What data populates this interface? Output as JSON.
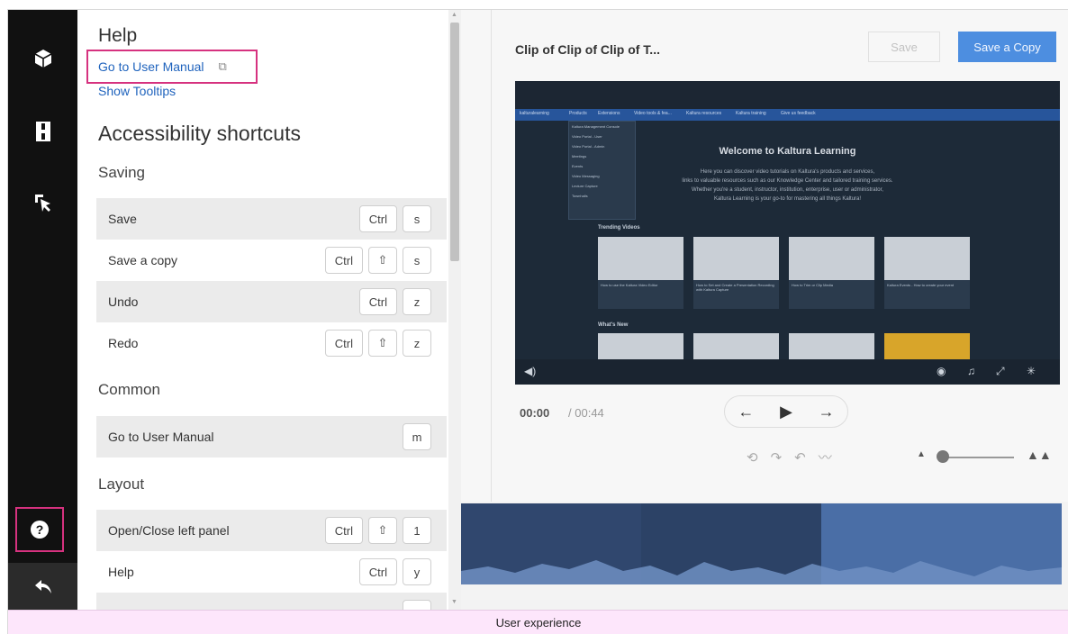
{
  "colors": {
    "highlight": "#d6327f",
    "link": "#1f63bd",
    "primary": "#4d8ee0",
    "rail": "#111111"
  },
  "rail": {
    "items": [
      {
        "icon": "cube-icon"
      },
      {
        "icon": "film-strip-icon"
      },
      {
        "icon": "cursor-select-icon"
      }
    ],
    "help_icon": "question-icon",
    "back_icon": "back-arrow-icon"
  },
  "help": {
    "title": "Help",
    "manual_link": "Go to User Manual",
    "manual_link_icon": "external-link-icon",
    "tooltips_link": "Show Tooltips",
    "accessibility_title": "Accessibility shortcuts",
    "sections": {
      "saving": {
        "title": "Saving",
        "rows": [
          {
            "label": "Save",
            "keys": [
              "Ctrl",
              "s"
            ]
          },
          {
            "label": "Save a copy",
            "keys": [
              "Ctrl",
              "⇧",
              "s"
            ]
          },
          {
            "label": "Undo",
            "keys": [
              "Ctrl",
              "z"
            ]
          },
          {
            "label": "Redo",
            "keys": [
              "Ctrl",
              "⇧",
              "z"
            ]
          }
        ]
      },
      "common": {
        "title": "Common",
        "rows": [
          {
            "label": "Go to User Manual",
            "keys": [
              "m"
            ]
          }
        ]
      },
      "layout": {
        "title": "Layout",
        "rows": [
          {
            "label": "Open/Close left panel",
            "keys": [
              "Ctrl",
              "⇧",
              "1"
            ]
          },
          {
            "label": "Help",
            "keys": [
              "Ctrl",
              "y"
            ]
          }
        ]
      }
    }
  },
  "editor": {
    "clip_title": "Clip of Clip of Clip of T...",
    "save_label": "Save",
    "save_copy_label": "Save a Copy",
    "time_current": "00:00",
    "time_separator": "/",
    "time_total": "00:44",
    "player": {
      "welcome_title": "Welcome to Kaltura Learning",
      "welcome_lines": [
        "Here you can discover video tutorials on Kaltura's products and services,",
        "links to valuable resources such as our Knowledge Center and tailored training services.",
        "Whether you're a student, instructor, institution, enterprise, user or administrator,",
        "Kaltura Learning is your go-to for mastering all things Kaltura!"
      ],
      "trending_label": "Trending Videos",
      "new_label": "What's New",
      "nav_items": [
        "Products",
        "Extensions",
        "Video tools & fea...",
        "Kaltura resources",
        "Kaltura training",
        "Give us feedback"
      ],
      "dropdown_items": [
        "Kaltura Management Console",
        "Video Portal - User",
        "Video Portal - Admin",
        "Meetings",
        "Events",
        "Video Messaging",
        "Lecture Capture",
        "Townhalls"
      ],
      "trending_cards": [
        "How to use the Kaltura Video Editor",
        "How to Set and Create a Presentation Recording with Kaltura Capture",
        "How to Trim or Clip Media",
        "Kaltura Events - How to create your event"
      ]
    }
  },
  "caption": "User experience"
}
